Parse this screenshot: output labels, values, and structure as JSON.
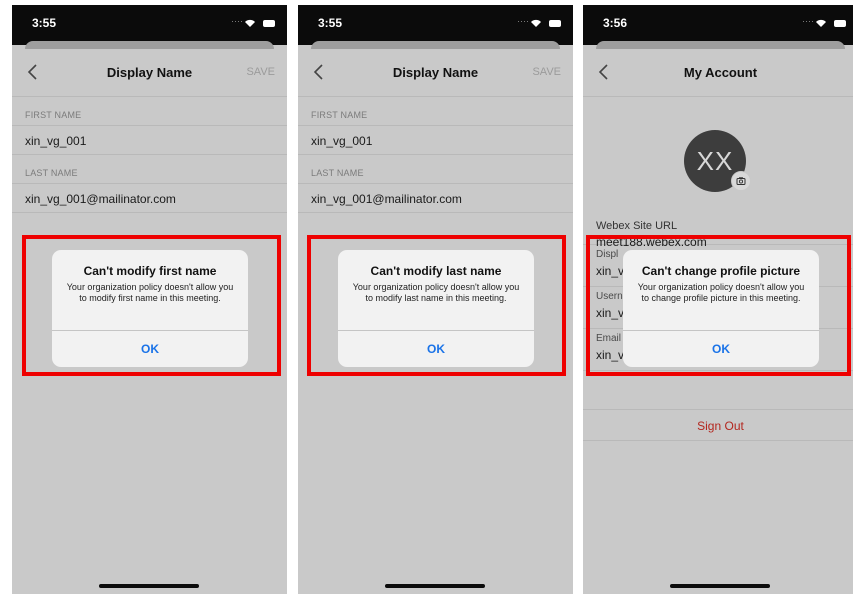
{
  "screens": [
    {
      "status_time": "3:55",
      "nav_title": "Display Name",
      "nav_action": "SAVE",
      "first_name_label": "FIRST NAME",
      "first_name_value": "xin_vg_001",
      "last_name_label": "LAST NAME",
      "last_name_value": "xin_vg_001@mailinator.com",
      "dialog": {
        "title": "Can't modify first name",
        "message": "Your organization policy doesn't allow you to modify first name in this meeting.",
        "button": "OK"
      }
    },
    {
      "status_time": "3:55",
      "nav_title": "Display Name",
      "nav_action": "SAVE",
      "first_name_label": "FIRST NAME",
      "first_name_value": "xin_vg_001",
      "last_name_label": "LAST NAME",
      "last_name_value": "xin_vg_001@mailinator.com",
      "dialog": {
        "title": "Can't modify last name",
        "message": "Your organization policy doesn't allow you to modify last name in this meeting.",
        "button": "OK"
      }
    },
    {
      "status_time": "3:56",
      "nav_title": "My Account",
      "avatar_initials": "XX",
      "site_url_label": "Webex Site URL",
      "site_url_value": "meet188.webex.com",
      "display_label": "Displ",
      "display_value": "xin_v",
      "username_label": "Usern",
      "username_value": "xin_v",
      "email_label": "Email",
      "email_value": "xin_vg_001@mailinator.com",
      "sign_out": "Sign Out",
      "dialog": {
        "title": "Can't change profile picture",
        "message": "Your organization policy doesn't allow you to change profile picture in this meeting.",
        "button": "OK"
      }
    }
  ],
  "colors": {
    "highlight": "#ee0000",
    "dialog_button": "#1a73e8",
    "sign_out": "#b3261e",
    "dimmed_background": "#c9c9c9"
  },
  "icons": {
    "back": "chevron-left-icon",
    "camera": "camera-icon",
    "row_chevron": "chevron-right-icon",
    "wifi": "wifi-icon",
    "battery": "battery-icon"
  }
}
